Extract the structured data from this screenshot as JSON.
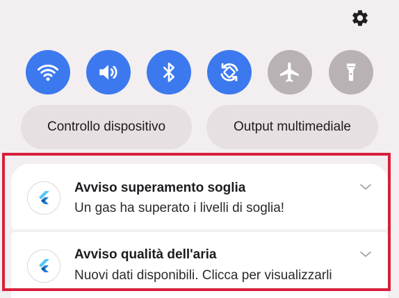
{
  "panel": {
    "settings_icon": "gear-icon"
  },
  "quick_settings": [
    {
      "name": "wifi",
      "icon": "wifi-icon",
      "state": "on"
    },
    {
      "name": "sound",
      "icon": "speaker-icon",
      "state": "on"
    },
    {
      "name": "bluetooth",
      "icon": "bluetooth-icon",
      "state": "on"
    },
    {
      "name": "auto-rotate",
      "icon": "rotate-icon",
      "state": "on"
    },
    {
      "name": "airplane-mode",
      "icon": "airplane-icon",
      "state": "off"
    },
    {
      "name": "flashlight",
      "icon": "flashlight-icon",
      "state": "off"
    }
  ],
  "buttons": {
    "device_control": "Controllo dispositivo",
    "media_output": "Output multimediale"
  },
  "notifications": [
    {
      "title": "Avviso superamento soglia",
      "body": "Un gas ha superato i livelli di soglia!",
      "icon": "flutter-icon"
    },
    {
      "title": "Avviso qualità dell'aria",
      "body": "Nuovi dati disponibili. Clicca per visualizzarli",
      "icon": "flutter-icon"
    }
  ],
  "colors": {
    "active_tile": "#3c79ee",
    "inactive_tile": "#b8b2b4",
    "highlight_border": "#d71f3a",
    "panel_background": "#f3eff1"
  }
}
